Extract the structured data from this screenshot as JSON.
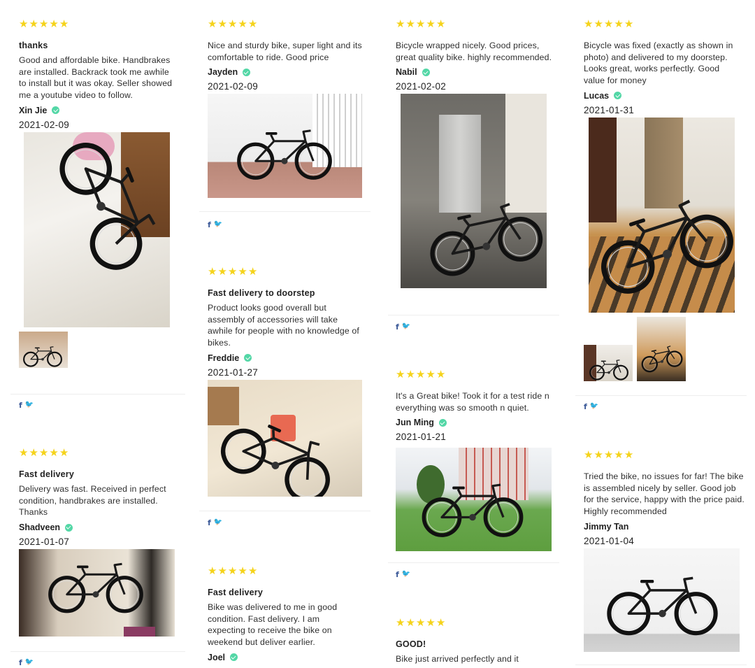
{
  "rating_symbol": "★",
  "colors": {
    "star": "#f5d31b",
    "verified": "#53d7a6",
    "facebook": "#3b5998",
    "twitter": "#55c8f0"
  },
  "social": {
    "facebook_glyph": "f",
    "twitter_glyph": "🐦"
  },
  "reviews": [
    {
      "rating": 5,
      "title": "thanks",
      "body": "Good and affordable bike. Handbrakes are installed. Backrack took me awhile to install but it was okay. Seller showed me a youtube video to follow.",
      "author": "Xin Jie",
      "verified": true,
      "date": "2021-02-09",
      "photos": 2
    },
    {
      "rating": 5,
      "title": "Fast delivery",
      "body": "Delivery was fast. Received in perfect condition, handbrakes are installed. Thanks",
      "author": "Shadveen",
      "verified": true,
      "date": "2021-01-07",
      "photos": 1
    },
    {
      "rating": 5,
      "title": "",
      "body": "Nice and sturdy bike, super light and its comfortable to ride. Good price",
      "author": "Jayden",
      "verified": true,
      "date": "2021-02-09",
      "photos": 1
    },
    {
      "rating": 5,
      "title": "Fast delivery to doorstep",
      "body": "Product looks good overall but assembly of accessories will take awhile for people with no knowledge of bikes.",
      "author": "Freddie",
      "verified": true,
      "date": "2021-01-27",
      "photos": 1
    },
    {
      "rating": 5,
      "title": "Fast delivery",
      "body": "Bike was delivered to me in good condition. Fast delivery. I am expecting to receive the bike on weekend but deliver earlier.",
      "author": "Joel",
      "verified": true,
      "date": "",
      "photos": 0
    },
    {
      "rating": 5,
      "title": "",
      "body": "Bicycle wrapped nicely. Good prices, great quality bike. highly recommended.",
      "author": "Nabil",
      "verified": true,
      "date": "2021-02-02",
      "photos": 1
    },
    {
      "rating": 5,
      "title": "",
      "body": "It's a Great bike! Took it for a test ride n everything was so smooth n quiet.",
      "author": "Jun Ming",
      "verified": true,
      "date": "2021-01-21",
      "photos": 1
    },
    {
      "rating": 5,
      "title": "GOOD!",
      "body": "Bike just arrived perfectly and it",
      "author": "",
      "verified": false,
      "date": "",
      "photos": 0
    },
    {
      "rating": 5,
      "title": "",
      "body": "Bicycle was fixed (exactly as shown in photo) and delivered to my doorstep. Looks great, works perfectly. Good value for money",
      "author": "Lucas",
      "verified": true,
      "date": "2021-01-31",
      "photos": 3
    },
    {
      "rating": 5,
      "title": "",
      "body": "Tried the bike, no issues for far! The bike is assembled nicely by seller. Good job for the service, happy with the price paid. Highly recommended",
      "author": "Jimmy Tan",
      "verified": false,
      "date": "2021-01-04",
      "photos": 1
    }
  ]
}
